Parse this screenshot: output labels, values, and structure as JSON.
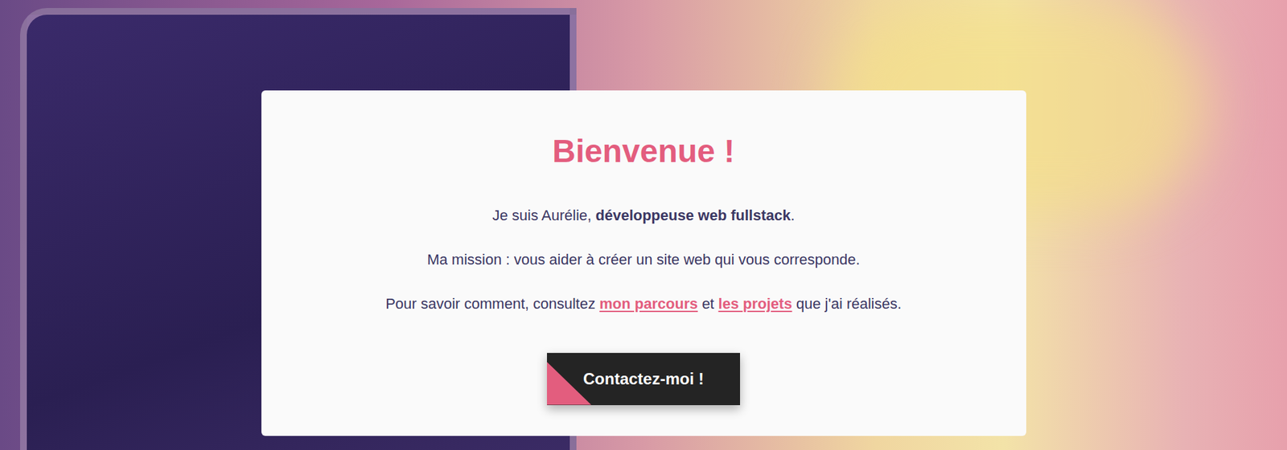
{
  "hero": {
    "title": "Bienvenue !",
    "paragraphs": [
      [
        {
          "kind": "text",
          "text": "Je suis Aurélie, "
        },
        {
          "kind": "bold",
          "text": "développeuse web fullstack"
        },
        {
          "kind": "text",
          "text": "."
        }
      ],
      [
        {
          "kind": "text",
          "text": "Ma mission : vous aider à créer un site web qui vous corresponde."
        }
      ],
      [
        {
          "kind": "text",
          "text": "Pour savoir comment, consultez "
        },
        {
          "kind": "link",
          "text": "mon parcours"
        },
        {
          "kind": "text",
          "text": " et "
        },
        {
          "kind": "link",
          "text": "les projets"
        },
        {
          "kind": "text",
          "text": " que j'ai réalisés."
        }
      ]
    ],
    "button": "Contactez-moi !"
  }
}
